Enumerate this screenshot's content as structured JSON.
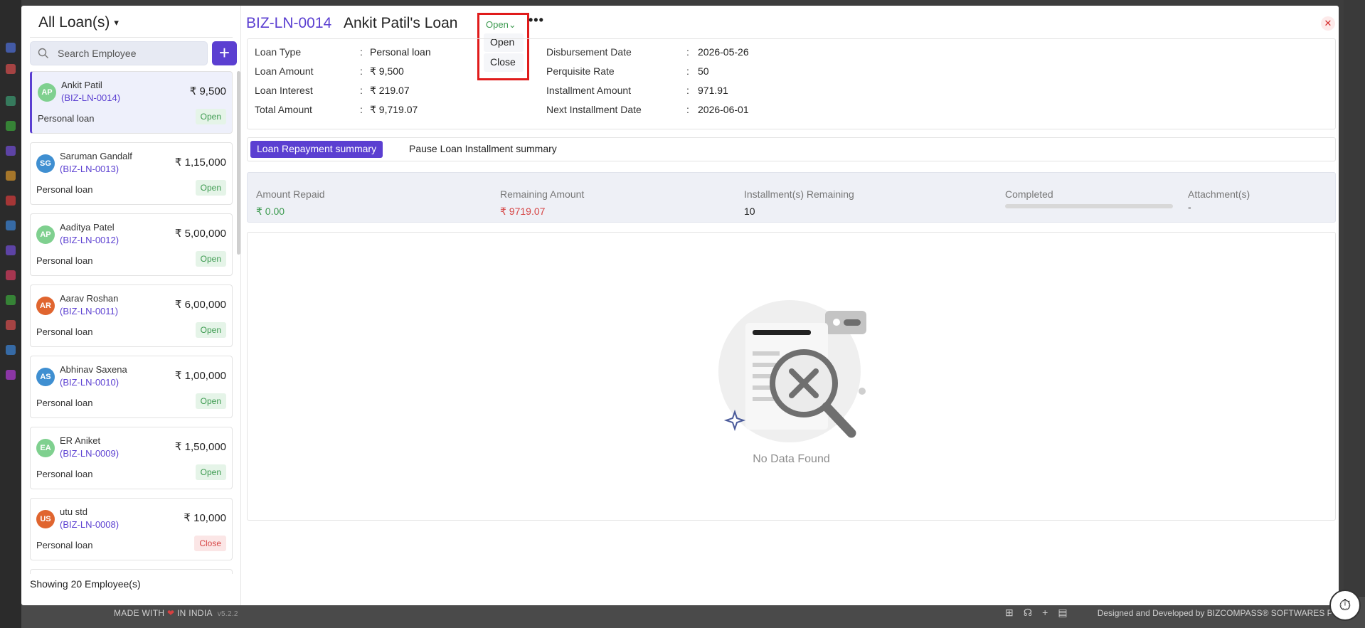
{
  "left": {
    "title": "All Loan(s)",
    "search_placeholder": "Search Employee",
    "add_label": "+",
    "showing": "Showing 20 Employee(s)",
    "cards": [
      {
        "initials": "AP",
        "name": "Ankit Patil",
        "code": "(BIZ-LN-0014)",
        "amount": "₹ 9,500",
        "type": "Personal loan",
        "status": "Open",
        "avatar_color": "#7fd08f"
      },
      {
        "initials": "SG",
        "name": "Saruman Gandalf",
        "code": "(BIZ-LN-0013)",
        "amount": "₹ 1,15,000",
        "type": "Personal loan",
        "status": "Open",
        "avatar_color": "#3f8fd1"
      },
      {
        "initials": "AP",
        "name": "Aaditya Patel",
        "code": "(BIZ-LN-0012)",
        "amount": "₹ 5,00,000",
        "type": "Personal loan",
        "status": "Open",
        "avatar_color": "#7fd08f"
      },
      {
        "initials": "AR",
        "name": "Aarav Roshan",
        "code": "(BIZ-LN-0011)",
        "amount": "₹ 6,00,000",
        "type": "Personal loan",
        "status": "Open",
        "avatar_color": "#e0652f"
      },
      {
        "initials": "AS",
        "name": "Abhinav Saxena",
        "code": "(BIZ-LN-0010)",
        "amount": "₹ 1,00,000",
        "type": "Personal loan",
        "status": "Open",
        "avatar_color": "#3f8fd1"
      },
      {
        "initials": "EA",
        "name": "ER Aniket",
        "code": "(BIZ-LN-0009)",
        "amount": "₹ 1,50,000",
        "type": "Personal loan",
        "status": "Open",
        "avatar_color": "#7fd08f"
      },
      {
        "initials": "US",
        "name": "utu std",
        "code": "(BIZ-LN-0008)",
        "amount": "₹ 10,000",
        "type": "Personal loan",
        "status": "Close",
        "avatar_color": "#e0652f"
      }
    ]
  },
  "header": {
    "loan_code": "BIZ-LN-0014",
    "loan_title": "Ankit Patil's Loan",
    "status_current": "Open",
    "status_options": [
      "Open",
      "Close"
    ],
    "more_label": "•••",
    "close_label": "✕"
  },
  "details": {
    "left": [
      {
        "key": "Loan Type",
        "value": "Personal loan"
      },
      {
        "key": "Loan Amount",
        "value": "₹ 9,500"
      },
      {
        "key": "Loan Interest",
        "value": "₹ 219.07"
      },
      {
        "key": "Total Amount",
        "value": "₹ 9,719.07"
      }
    ],
    "right": [
      {
        "key": "Disbursement Date",
        "value": "2026-05-26"
      },
      {
        "key": "Perquisite Rate",
        "value": "50"
      },
      {
        "key": "Installment Amount",
        "value": "971.91"
      },
      {
        "key": "Next Installment Date",
        "value": "2026-06-01"
      }
    ]
  },
  "tabs": [
    "Loan Repayment summary",
    "Pause Loan Installment summary"
  ],
  "summary": {
    "amount_repaid_label": "Amount Repaid",
    "amount_repaid": "₹ 0.00",
    "remaining_label": "Remaining Amount",
    "remaining": "₹ 9719.07",
    "installments_label": "Installment(s) Remaining",
    "installments": "10",
    "completed_label": "Completed",
    "completed_fraction": 0,
    "attachments_label": "Attachment(s)",
    "attachments": "-"
  },
  "empty_state": "No Data Found",
  "footer": {
    "made_prefix": "MADE WITH",
    "made_suffix": "IN INDIA",
    "version": "v5.2.2",
    "designed": "Designed and Developed by  BIZCOMPASS® SOFTWARES PVT"
  },
  "colors": {
    "accent": "#5b3fd1",
    "open": "#3c9a4f",
    "close": "#d64545",
    "highlight": "#e01b1b"
  }
}
